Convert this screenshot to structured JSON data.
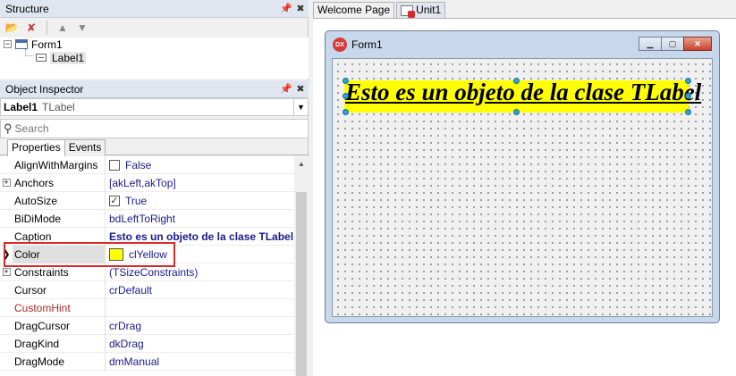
{
  "structure": {
    "title": "Structure",
    "tree": [
      {
        "label": "Form1"
      },
      {
        "label": "Label1"
      }
    ]
  },
  "inspector": {
    "title": "Object Inspector",
    "selected_name": "Label1",
    "selected_class": "TLabel",
    "search_placeholder": "Search",
    "tabs": [
      "Properties",
      "Events"
    ],
    "properties": [
      {
        "name": "AlignWithMargins",
        "value": "False",
        "control": "checkbox",
        "checked": false
      },
      {
        "name": "Anchors",
        "value": "[akLeft,akTop]",
        "expander": true
      },
      {
        "name": "AutoSize",
        "value": "True",
        "control": "checkbox",
        "checked": true
      },
      {
        "name": "BiDiMode",
        "value": "bdLeftToRight"
      },
      {
        "name": "Caption",
        "value": "Esto es un objeto de la clase TLabel",
        "bold": true
      },
      {
        "name": "Color",
        "value": "clYellow",
        "control": "swatch",
        "swatch_color": "#ffff00",
        "selected": true
      },
      {
        "name": "Constraints",
        "value": "(TSizeConstraints)",
        "expander": true
      },
      {
        "name": "Cursor",
        "value": "crDefault"
      },
      {
        "name": "CustomHint",
        "value": "",
        "hint": true
      },
      {
        "name": "DragCursor",
        "value": "crDrag"
      },
      {
        "name": "DragKind",
        "value": "dkDrag"
      },
      {
        "name": "DragMode",
        "value": "dmManual"
      }
    ]
  },
  "editor": {
    "tabs": [
      "Welcome Page",
      "Unit1"
    ],
    "active_tab": "Unit1"
  },
  "designer": {
    "form_caption": "Form1",
    "form_icon_text": "DX",
    "label_caption": "Esto es un objeto de la clase TLabel",
    "label_color": "#ffff00"
  },
  "colors": {
    "accent_red": "#d42a2a",
    "panel_header": "#dfe6f0",
    "handle": "#29a3d6"
  }
}
